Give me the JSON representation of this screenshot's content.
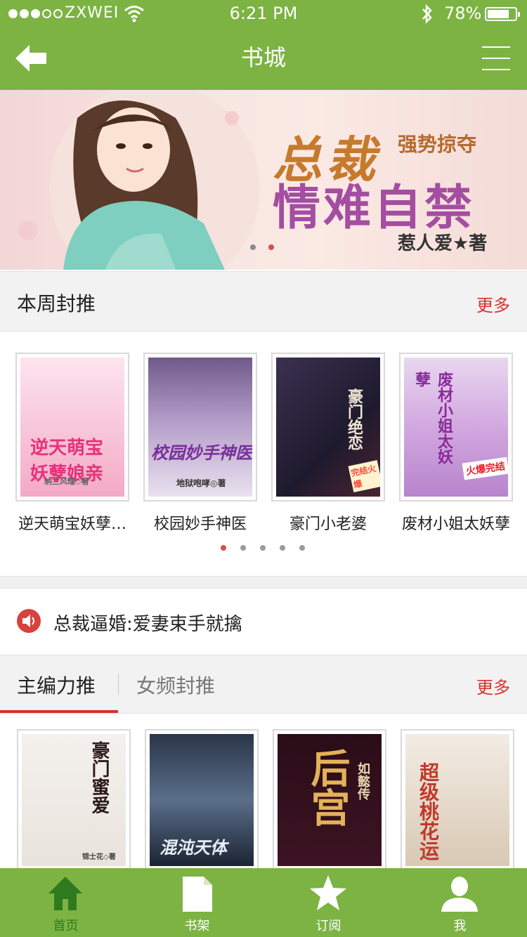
{
  "status_bar": {
    "carrier": "ZXWEI",
    "time": "6:21 PM",
    "battery": "78%",
    "battery_level": 0.78,
    "signal_bars": 3
  },
  "nav": {
    "title": "书城",
    "back_icon": "arrow-left-icon",
    "menu_icon": "hamburger-menu-icon"
  },
  "banner": {
    "tagline": "强势掠夺",
    "title_line1": "总裁",
    "title_line2": "情难自禁",
    "author": "惹人爱★著",
    "dot_count": 2,
    "active_dot": 1
  },
  "weekly": {
    "title": "本周封推",
    "more": "更多",
    "books": [
      {
        "caption": "逆天萌宝妖孽…",
        "cover_text": "逆天萌宝 妖孽娘亲",
        "cover_sub": "纳兰风瑾◇著"
      },
      {
        "caption": "校园妙手神医",
        "cover_text": "校园妙手神医",
        "cover_sub": "地狱咆哮◎著"
      },
      {
        "caption": "豪门小老婆",
        "cover_text": "豪门绝恋",
        "cover_sub": "完结火爆"
      },
      {
        "caption": "废材小姐太妖孽",
        "cover_text": "废材小姐太妖孽",
        "cover_sub": "火爆完结"
      }
    ],
    "dot_count": 5,
    "active_dot": 0
  },
  "notice": {
    "icon": "speaker-icon",
    "text": "总裁逼婚:爱妻束手就擒"
  },
  "editor_tabs": {
    "tabs": [
      "主编力推",
      "女频封推"
    ],
    "active": 0,
    "more": "更多",
    "books": [
      {
        "cover_text": "豪门蜜爱",
        "cover_sub": "锦士花◇著"
      },
      {
        "cover_text": "混沌天体",
        "cover_sub": ""
      },
      {
        "cover_text": "后宫",
        "cover_sub": "如懿传"
      },
      {
        "cover_text": "超级桃花运",
        "cover_sub": ""
      }
    ]
  },
  "tabbar": {
    "items": [
      {
        "label": "首页",
        "icon": "home-icon"
      },
      {
        "label": "书架",
        "icon": "bookshelf-icon"
      },
      {
        "label": "订阅",
        "icon": "star-icon"
      },
      {
        "label": "我",
        "icon": "user-icon"
      }
    ],
    "active": 0
  },
  "colors": {
    "brand_green": "#7cb342",
    "accent_red": "#d9302b"
  }
}
